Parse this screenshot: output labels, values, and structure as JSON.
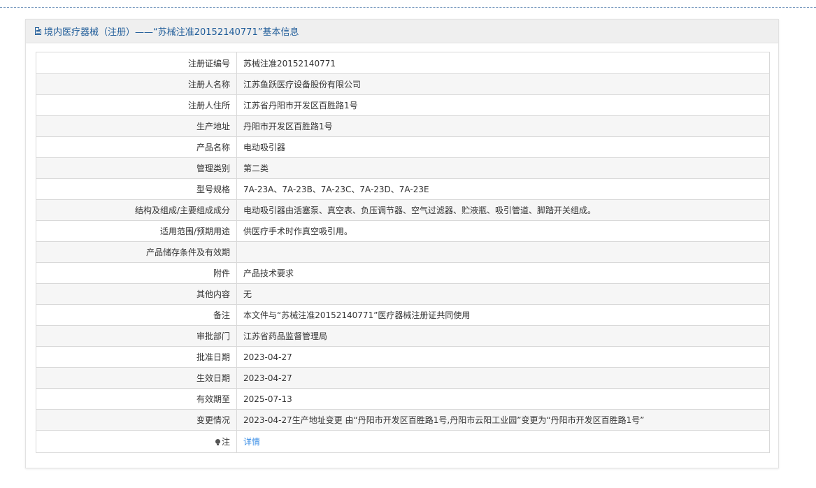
{
  "panel": {
    "title": "境内医疗器械（注册）——“苏械注准20152140771”基本信息",
    "title_icon": "document-icon"
  },
  "rows": [
    {
      "label": "注册证编号",
      "value": "苏械注准20152140771"
    },
    {
      "label": "注册人名称",
      "value": "江苏鱼跃医疗设备股份有限公司"
    },
    {
      "label": "注册人住所",
      "value": "江苏省丹阳市开发区百胜路1号"
    },
    {
      "label": "生产地址",
      "value": "丹阳市开发区百胜路1号"
    },
    {
      "label": "产品名称",
      "value": "电动吸引器"
    },
    {
      "label": "管理类别",
      "value": "第二类"
    },
    {
      "label": "型号规格",
      "value": "7A-23A、7A-23B、7A-23C、7A-23D、7A-23E"
    },
    {
      "label": "结构及组成/主要组成成分",
      "value": "电动吸引器由活塞泵、真空表、负压调节器、空气过滤器、贮液瓶、吸引管道、脚踏开关组成。"
    },
    {
      "label": "适用范围/预期用途",
      "value": "供医疗手术时作真空吸引用。"
    },
    {
      "label": "产品储存条件及有效期",
      "value": ""
    },
    {
      "label": "附件",
      "value": "产品技术要求"
    },
    {
      "label": "其他内容",
      "value": "无"
    },
    {
      "label": "备注",
      "value": "本文件与“苏械注准20152140771”医疗器械注册证共同使用"
    },
    {
      "label": "审批部门",
      "value": "江苏省药品监督管理局"
    },
    {
      "label": "批准日期",
      "value": "2023-04-27"
    },
    {
      "label": "生效日期",
      "value": "2023-04-27"
    },
    {
      "label": "有效期至",
      "value": "2025-07-13"
    },
    {
      "label": "变更情况",
      "value": "2023-04-27生产地址变更 由“丹阳市开发区百胜路1号,丹阳市云阳工业园”变更为“丹阳市开发区百胜路1号”"
    }
  ],
  "note_row": {
    "label": "注",
    "link_text": "详情",
    "icon": "lightbulb-icon"
  },
  "colors": {
    "title": "#1f5c99",
    "link": "#3a8ee6",
    "header_bg": "#efefef",
    "alt_row_bg": "#f6f6f6",
    "border": "#d9d9d9"
  }
}
